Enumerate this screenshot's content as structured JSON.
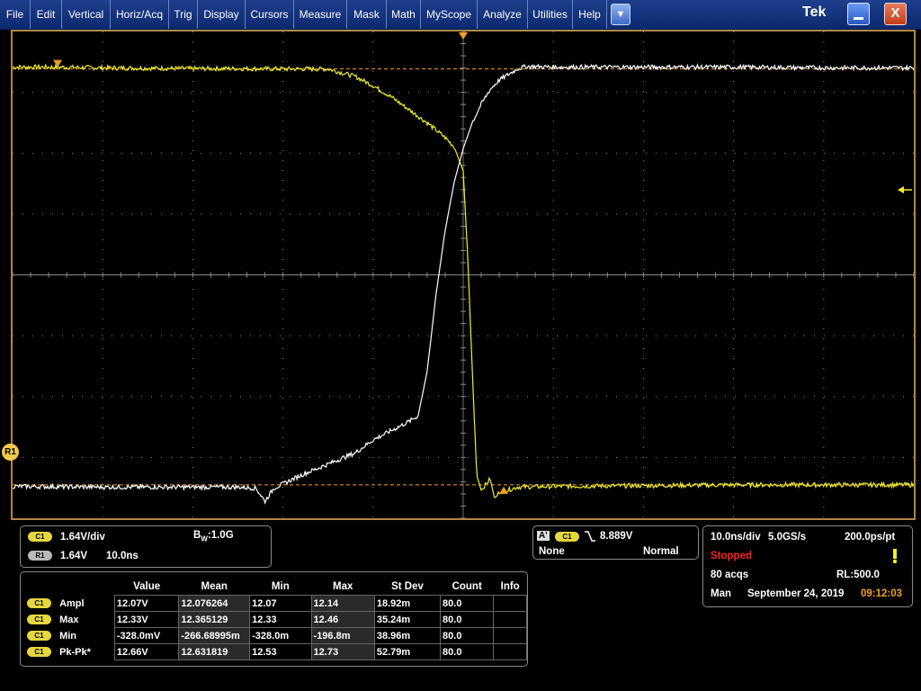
{
  "menu": {
    "items": [
      "File",
      "Edit",
      "Vertical",
      "Horiz/Acq",
      "Trig",
      "Display",
      "Cursors",
      "Measure",
      "Mask",
      "Math",
      "MyScope",
      "Analyze",
      "Utilities",
      "Help"
    ],
    "dropdown_icon": "triangle-down-icon",
    "brand": "Tek",
    "minimize_icon": "minimize-icon",
    "close_icon": "close-icon",
    "close_glyph": "X"
  },
  "colors": {
    "channel1": "#f2ee2a",
    "reference1": "#ffffff",
    "graticule": "#8a8a8a",
    "cursor": "#f0a020",
    "stopped": "#ff2020",
    "time": "#f0a020"
  },
  "scope": {
    "reference_marker": "R1",
    "divisions": {
      "horizontal": 10,
      "vertical": 8
    },
    "trigger_level_arrow": "arrow-left-icon"
  },
  "chart_data": {
    "type": "line",
    "xlabel": "",
    "ylabel": "",
    "xlim": [
      -50,
      50
    ],
    "ylim": [
      -6.56,
      6.56
    ],
    "x_units": "ns",
    "y_units": "V",
    "grid": true,
    "series": [
      {
        "name": "C1",
        "x": [
          -50,
          -45,
          -40,
          -35,
          -30,
          -25,
          -20,
          -15,
          -12,
          -10,
          -8,
          -6,
          -4,
          -3,
          -2,
          -1,
          0,
          0.5,
          1,
          1.5,
          2,
          2.5,
          3,
          3.5,
          4,
          5,
          6,
          10,
          20,
          30,
          40,
          50
        ],
        "values": [
          5.6,
          5.6,
          5.58,
          5.57,
          5.56,
          5.56,
          5.55,
          5.55,
          5.35,
          5.1,
          4.8,
          4.45,
          4.1,
          3.9,
          3.7,
          3.45,
          2.8,
          0.5,
          -2.5,
          -5.4,
          -5.8,
          -5.65,
          -5.5,
          -6.05,
          -5.85,
          -5.8,
          -5.72,
          -5.7,
          -5.68,
          -5.66,
          -5.66,
          -5.66
        ]
      },
      {
        "name": "R1",
        "x": [
          -50,
          -40,
          -30,
          -25,
          -23,
          -22,
          -21,
          -18,
          -15,
          -12,
          -10,
          -8,
          -6,
          -5,
          -4,
          -3,
          -2,
          -1,
          0,
          1,
          2,
          3,
          4,
          5,
          6,
          7,
          10,
          20,
          30,
          40,
          50
        ],
        "values": [
          -5.7,
          -5.72,
          -5.72,
          -5.72,
          -5.75,
          -6.1,
          -5.75,
          -5.4,
          -5.1,
          -4.8,
          -4.45,
          -4.2,
          -3.95,
          -3.8,
          -2.6,
          -0.5,
          1.2,
          2.5,
          3.4,
          4.1,
          4.6,
          5.0,
          5.25,
          5.4,
          5.55,
          5.62,
          5.6,
          5.6,
          5.6,
          5.58,
          5.58
        ]
      }
    ],
    "cursors": {
      "h1": 5.55,
      "h2": -5.66,
      "v1": -45,
      "v2": 4.5
    }
  },
  "channel_info": {
    "c1_badge": "C1",
    "c1_scale": "1.64V/div",
    "bw": "1.0G",
    "bw_prefix": "B",
    "bw_sub": "W",
    "r1_badge": "R1",
    "r1_scale": "1.64V",
    "r1_time": "10.0ns"
  },
  "trigger_info": {
    "a_badge": "A'",
    "source_badge": "C1",
    "slope_icon": "falling-edge-icon",
    "level": "8.889V",
    "coupling": "None",
    "mode": "Normal"
  },
  "acq_info": {
    "timebase": "10.0ns/div",
    "sample_rate": "5.0GS/s",
    "resolution": "200.0ps/pt",
    "state": "Stopped",
    "acqs": "80 acqs",
    "record_length": "RL:500.0",
    "mode": "Man",
    "date": "September 24, 2019",
    "time": "09:12:03",
    "status_icon": "exclamation-icon"
  },
  "measurements": {
    "headers": [
      "Value",
      "Mean",
      "Min",
      "Max",
      "St Dev",
      "Count",
      "Info"
    ],
    "rows": [
      {
        "badge": "C1",
        "name": "Ampl",
        "value": "12.07V",
        "mean": "12.076264",
        "min": "12.07",
        "max": "12.14",
        "stdev": "18.92m",
        "count": "80.0",
        "info": ""
      },
      {
        "badge": "C1",
        "name": "Max",
        "value": "12.33V",
        "mean": "12.365129",
        "min": "12.33",
        "max": "12.46",
        "stdev": "35.24m",
        "count": "80.0",
        "info": ""
      },
      {
        "badge": "C1",
        "name": "Min",
        "value": "-328.0mV",
        "mean": "-266.68995m",
        "min": "-328.0m",
        "max": "-196.8m",
        "stdev": "38.96m",
        "count": "80.0",
        "info": ""
      },
      {
        "badge": "C1",
        "name": "Pk-Pk*",
        "value": "12.66V",
        "mean": "12.631819",
        "min": "12.53",
        "max": "12.73",
        "stdev": "52.79m",
        "count": "80.0",
        "info": ""
      }
    ]
  }
}
